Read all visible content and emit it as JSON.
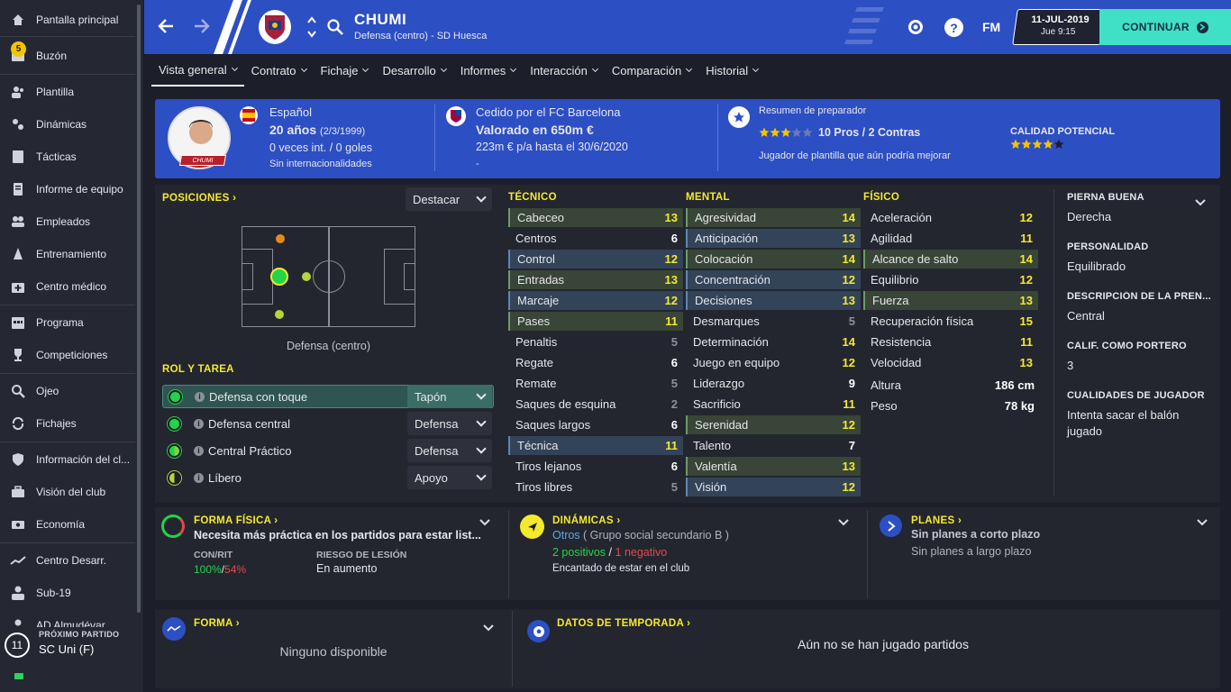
{
  "sidebar": {
    "items": [
      {
        "label": "Pantalla principal"
      },
      {
        "label": "Buzón"
      },
      {
        "label": "Plantilla"
      },
      {
        "label": "Dinámicas"
      },
      {
        "label": "Tácticas"
      },
      {
        "label": "Informe de equipo"
      },
      {
        "label": "Empleados"
      },
      {
        "label": "Entrenamiento"
      },
      {
        "label": "Centro médico"
      },
      {
        "label": "Programa"
      },
      {
        "label": "Competiciones"
      },
      {
        "label": "Ojeo"
      },
      {
        "label": "Fichajes"
      },
      {
        "label": "Información del cl..."
      },
      {
        "label": "Visión del club"
      },
      {
        "label": "Economía"
      },
      {
        "label": "Centro Desarr."
      },
      {
        "label": "Sub-19"
      },
      {
        "label": "AD Almudévar"
      }
    ],
    "badge": "5",
    "next_match": {
      "label": "PRÓXIMO PARTIDO",
      "day": "11",
      "team": "SC Uni (F)"
    }
  },
  "header": {
    "name": "CHUMI",
    "subtitle": "Defensa (centro) - SD Huesca",
    "logo_text": "FM",
    "date": "11-JUL-2019",
    "time": "Jue 9:15",
    "continue": "CONTINUAR"
  },
  "tabs": [
    "Vista general",
    "Contrato",
    "Fichaje",
    "Desarrollo",
    "Informes",
    "Interacción",
    "Comparación",
    "Historial"
  ],
  "info": {
    "portrait_name": "CHUMI",
    "nationality": "Español",
    "age": "20 años",
    "dob": "(2/3/1999)",
    "caps": "0 veces int. / 0 goles",
    "intl": "Sin internacionalidades",
    "loan": "Cedido por el FC Barcelona",
    "value": "Valorado en 650m €",
    "wage": "223m € p/a hasta el 30/6/2020",
    "dash": "-",
    "coach_title": "Resumen de preparador",
    "pros_cons": "10 Pros / 2 Contras",
    "coach_note": "Jugador de plantilla que aún podría mejorar",
    "current_stars": 3,
    "potential_title": "CALIDAD POTENCIAL",
    "potential_stars": 4
  },
  "positions": {
    "title": "POSICIONES",
    "highlight": "Destacar",
    "caption": "Defensa (centro)"
  },
  "roles": {
    "title": "ROL Y TAREA",
    "items": [
      {
        "role": "Defensa con toque",
        "duty": "Tapón"
      },
      {
        "role": "Defensa central",
        "duty": "Defensa"
      },
      {
        "role": "Central Práctico",
        "duty": "Defensa"
      },
      {
        "role": "Líbero",
        "duty": "Apoyo"
      }
    ]
  },
  "tecnico": {
    "title": "TÉCNICO",
    "items": [
      {
        "n": "Cabeceo",
        "v": "13",
        "h": "g"
      },
      {
        "n": "Centros",
        "v": "6",
        "h": ""
      },
      {
        "n": "Control",
        "v": "12",
        "h": "b"
      },
      {
        "n": "Entradas",
        "v": "13",
        "h": "g"
      },
      {
        "n": "Marcaje",
        "v": "12",
        "h": "b"
      },
      {
        "n": "Pases",
        "v": "11",
        "h": "g"
      },
      {
        "n": "Penaltis",
        "v": "5",
        "h": ""
      },
      {
        "n": "Regate",
        "v": "6",
        "h": ""
      },
      {
        "n": "Remate",
        "v": "5",
        "h": ""
      },
      {
        "n": "Saques de esquina",
        "v": "2",
        "h": ""
      },
      {
        "n": "Saques largos",
        "v": "6",
        "h": ""
      },
      {
        "n": "Técnica",
        "v": "11",
        "h": "b"
      },
      {
        "n": "Tiros lejanos",
        "v": "6",
        "h": ""
      },
      {
        "n": "Tiros libres",
        "v": "5",
        "h": ""
      }
    ]
  },
  "mental": {
    "title": "MENTAL",
    "items": [
      {
        "n": "Agresividad",
        "v": "14",
        "h": "g"
      },
      {
        "n": "Anticipación",
        "v": "13",
        "h": "b"
      },
      {
        "n": "Colocación",
        "v": "14",
        "h": "g"
      },
      {
        "n": "Concentración",
        "v": "12",
        "h": "b"
      },
      {
        "n": "Decisiones",
        "v": "13",
        "h": "b"
      },
      {
        "n": "Desmarques",
        "v": "5",
        "h": ""
      },
      {
        "n": "Determinación",
        "v": "14",
        "h": ""
      },
      {
        "n": "Juego en equipo",
        "v": "12",
        "h": ""
      },
      {
        "n": "Liderazgo",
        "v": "9",
        "h": ""
      },
      {
        "n": "Sacrificio",
        "v": "11",
        "h": ""
      },
      {
        "n": "Serenidad",
        "v": "12",
        "h": "g"
      },
      {
        "n": "Talento",
        "v": "7",
        "h": ""
      },
      {
        "n": "Valentía",
        "v": "13",
        "h": "g"
      },
      {
        "n": "Visión",
        "v": "12",
        "h": "b"
      }
    ]
  },
  "fisico": {
    "title": "FÍSICO",
    "items": [
      {
        "n": "Aceleración",
        "v": "12",
        "h": ""
      },
      {
        "n": "Agilidad",
        "v": "11",
        "h": ""
      },
      {
        "n": "Alcance de salto",
        "v": "14",
        "h": "g"
      },
      {
        "n": "Equilibrio",
        "v": "12",
        "h": ""
      },
      {
        "n": "Fuerza",
        "v": "13",
        "h": "g"
      },
      {
        "n": "Recuperación física",
        "v": "15",
        "h": ""
      },
      {
        "n": "Resistencia",
        "v": "11",
        "h": ""
      },
      {
        "n": "Velocidad",
        "v": "13",
        "h": ""
      }
    ],
    "height_label": "Altura",
    "height": "186 cm",
    "weight_label": "Peso",
    "weight": "78 kg"
  },
  "details": [
    {
      "label": "PIERNA BUENA",
      "value": "Derecha"
    },
    {
      "label": "PERSONALIDAD",
      "value": "Equilibrado"
    },
    {
      "label": "DESCRIPCIÓN DE LA PREN...",
      "value": "Central"
    },
    {
      "label": "CALIF. COMO PORTERO",
      "value": "3"
    },
    {
      "label": "CUALIDADES DE JUGADOR",
      "value": "Intenta sacar el balón jugado"
    }
  ],
  "forma_fisica": {
    "title": "FORMA FÍSICA",
    "text": "Necesita más práctica en los partidos para estar list...",
    "conrit_label": "CON/RIT",
    "con": "100%",
    "sep": "/",
    "rit": "54%",
    "riesgo_label": "RIESGO DE LESIÓN",
    "riesgo": "En aumento"
  },
  "dinamicas": {
    "title": "DINÁMICAS",
    "group": "Otros",
    "group_detail": "( Grupo social secundario B )",
    "pos": "2 positivos",
    "slash": "/",
    "neg": "1 negativo",
    "mood": "Encantado de estar en el club"
  },
  "planes": {
    "title": "PLANES",
    "short": "Sin planes a corto plazo",
    "long": "Sin planes a largo plazo"
  },
  "forma": {
    "title": "FORMA",
    "empty": "Ninguno disponible"
  },
  "temporada": {
    "title": "DATOS DE TEMPORADA",
    "empty": "Aún no se han jugado partidos"
  },
  "colors": {
    "accent": "#2d4fc4",
    "highlight": "#f5e92d",
    "teal": "#3fe0c5",
    "green": "#22d44a",
    "red": "#e44848"
  }
}
